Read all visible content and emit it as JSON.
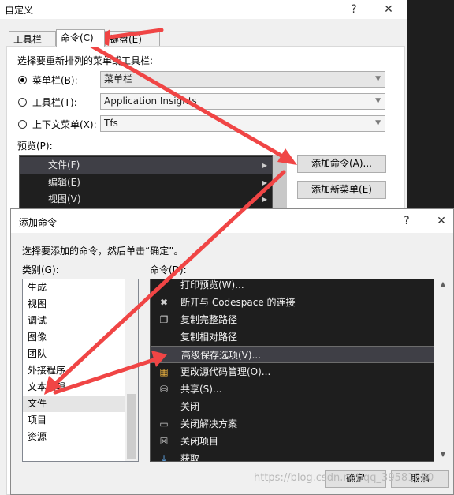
{
  "outer_dialog": {
    "title": "自定义",
    "help_label": "?",
    "close_label": "✕",
    "tabs": [
      {
        "label": "工具栏(S)",
        "active": false
      },
      {
        "label": "命令(C)",
        "active": true
      },
      {
        "label": "键盘(E)",
        "active": false
      }
    ],
    "choose_label": "选择要重新排列的菜单或工具栏:",
    "options": [
      {
        "label": "菜单栏(B):",
        "selected": true,
        "combo": "菜单栏",
        "enabled": true
      },
      {
        "label": "工具栏(T):",
        "selected": false,
        "combo": "Application Insights",
        "enabled": false
      },
      {
        "label": "上下文菜单(X):",
        "selected": false,
        "combo": "Tfs",
        "enabled": false
      }
    ],
    "preview_label": "预览(P):",
    "preview_items": [
      "文件(F)",
      "编辑(E)",
      "视图(V)"
    ],
    "add_command_button": "添加命令(A)...",
    "add_menu_button": "添加新菜单(E)"
  },
  "inner_dialog": {
    "title": "添加命令",
    "help_label": "?",
    "close_label": "✕",
    "instruction": "选择要添加的命令，然后单击“确定”。",
    "category_label": "类别(G):",
    "command_label": "命令(D):",
    "categories": [
      "生成",
      "视图",
      "调试",
      "图像",
      "团队",
      "外接程序",
      "文本编辑",
      "文件",
      "项目",
      "资源"
    ],
    "selected_category": "文件",
    "commands": [
      {
        "label": "打印预览(W)...",
        "icon": "none"
      },
      {
        "label": "断开与 Codespace 的连接",
        "icon": "plug-icon"
      },
      {
        "label": "复制完整路径",
        "icon": "copy-icon"
      },
      {
        "label": "复制相对路径",
        "icon": "none"
      },
      {
        "label": "高级保存选项(V)...",
        "icon": "none"
      },
      {
        "label": "更改源代码管理(O)...",
        "icon": "source-control-icon"
      },
      {
        "label": "共享(S)...",
        "icon": "share-icon"
      },
      {
        "label": "关闭",
        "icon": "none"
      },
      {
        "label": "关闭解决方案",
        "icon": "close-solution-icon"
      },
      {
        "label": "关闭项目",
        "icon": "close-project-icon"
      },
      {
        "label": "获取",
        "icon": "get-icon"
      }
    ],
    "selected_command": "高级保存选项(V)...",
    "ok_button": "确定",
    "cancel_button": "取消"
  },
  "watermark": "https://blog.csdn.net/qq_39581880",
  "colors": {
    "annotation_arrow": "#f04545",
    "dark_list": "#1e1e1e",
    "dialog_bg": "#f0f0f0"
  }
}
